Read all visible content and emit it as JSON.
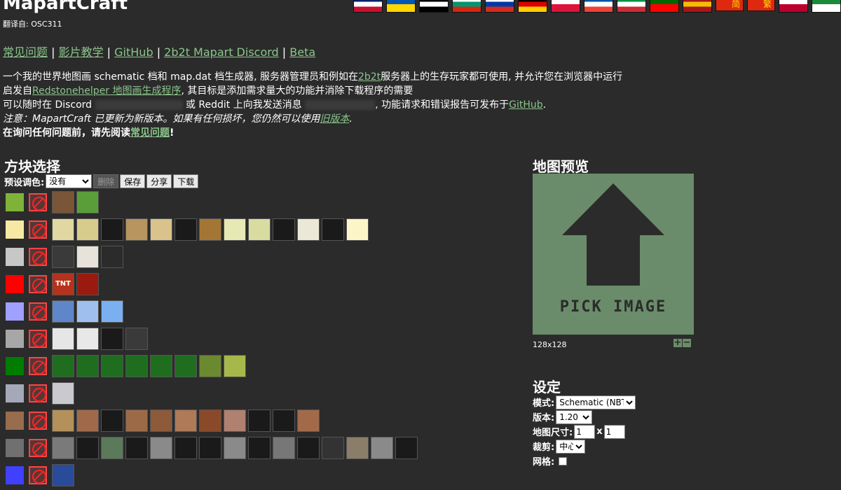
{
  "title": "MapartCraft",
  "translated_by": "翻译自: OSC311",
  "flags": [
    {
      "name": "en",
      "colors": [
        "#012169",
        "#ffffff",
        "#c8102e"
      ]
    },
    {
      "name": "ua",
      "colors": [
        "#0057b7",
        "#ffd700"
      ]
    },
    {
      "name": "de-old",
      "colors": [
        "#000000",
        "#ffffff",
        "#000000"
      ]
    },
    {
      "name": "bg",
      "colors": [
        "#ffffff",
        "#00966e",
        "#d62612"
      ]
    },
    {
      "name": "ru",
      "colors": [
        "#ffffff",
        "#0039a6",
        "#d52b1e"
      ]
    },
    {
      "name": "de",
      "colors": [
        "#000000",
        "#dd0000",
        "#ffce00"
      ]
    },
    {
      "name": "pl",
      "colors": [
        "#ffffff",
        "#dc143c"
      ]
    },
    {
      "name": "fr",
      "colors": [
        "#0055a4",
        "#ffffff",
        "#ef4135"
      ]
    },
    {
      "name": "it",
      "colors": [
        "#009246",
        "#ffffff",
        "#ce2b37"
      ]
    },
    {
      "name": "pt",
      "colors": [
        "#006600",
        "#ff0000"
      ]
    },
    {
      "name": "es",
      "colors": [
        "#aa151b",
        "#f1bf00",
        "#aa151b"
      ]
    },
    {
      "name": "zh-cn",
      "colors": [
        "#de2910",
        "#de2910"
      ],
      "label": "简"
    },
    {
      "name": "zh-tw",
      "colors": [
        "#de2910",
        "#de2910"
      ],
      "label": "繁"
    },
    {
      "name": "jp",
      "colors": [
        "#ffffff",
        "#bc002d"
      ]
    },
    {
      "name": "extra",
      "colors": [
        "#1b8a3a",
        "#ffffff"
      ]
    }
  ],
  "nav": {
    "faq": "常见问题",
    "video": "影片教学",
    "github": "GitHub",
    "discord": "2b2t Mapart Discord",
    "beta": "Beta"
  },
  "desc": {
    "line1_a": "一个我的世界地图画 schematic 档和 map.dat 档生成器, 服务器管理员和例如在",
    "line1_link": "2b2t",
    "line1_b": "服务器上的生存玩家都可使用, 并允许您在浏览器中运行",
    "line2_a": "启发自",
    "line2_link": "Redstonehelper 地图画生成程序",
    "line2_b": ", 其目标是添加需求量大的功能并消除下载程序的需要",
    "line3_a": "可以随时在 Discord",
    "line3_b": "或 Reddit 上向我发送消息",
    "line3_c": ", 功能请求和错误报告可发布于",
    "line3_link": "GitHub",
    "line3_d": ".",
    "line4_a": "注意：MapartCraft 已更新为新版本。如果有任何损坏，您仍然可以使用",
    "line4_link": "旧版本",
    "line4_b": ".",
    "line5_a": "在询问任何问题前，请先阅读",
    "line5_link": "常见问题",
    "line5_b": "!"
  },
  "blocks": {
    "heading": "方块选择",
    "preset_label": "预设调色:",
    "preset_value": "没有",
    "delete": "删除",
    "save": "保存",
    "share": "分享",
    "download": "下载",
    "tnt_label": "TNT",
    "rows": [
      {
        "swatch": "#7fb238",
        "tiles": [
          "#7a5537",
          "#5a9e3a"
        ]
      },
      {
        "swatch": "#f7e9a3",
        "tiles": [
          "#e0d7a2",
          "#d8cc8c",
          "#1a1a1a",
          "#b8945f",
          "#d9c28c",
          "#1a1a1a",
          "#a47636",
          "#e7e9b5",
          "#d8dca0",
          "#1a1a1a",
          "#ece8d8",
          "#1a1a1a",
          "#fcf5c7"
        ]
      },
      {
        "swatch": "#c7c7c7",
        "tiles": [
          "#3a3a3a",
          "#e7e2da",
          "#2b2b2b"
        ]
      },
      {
        "swatch": "#ff0000",
        "tiles": [
          "#b5321c",
          "#9a1a0f"
        ]
      },
      {
        "swatch": "#a0a0ff",
        "tiles": [
          "#5f86c8",
          "#9fc0ef",
          "#7ab0f0"
        ]
      },
      {
        "swatch": "#a7a7a7",
        "tiles": [
          "#e6e6e6",
          "#e8e8e8",
          "#1a1a1a",
          "#3a3a3a"
        ]
      },
      {
        "swatch": "#007c00",
        "tiles": [
          "#1f6e1f",
          "#1f6e1f",
          "#1f6e1f",
          "#1f6e1f",
          "#1f6e1f",
          "#1f6e1f",
          "#6b8a2f",
          "#a7b84a"
        ]
      },
      {
        "swatch": "#a4a8b8",
        "tiles": [
          "#c9c9cf"
        ]
      },
      {
        "swatch": "#976d4d",
        "tiles": [
          "#b4905a",
          "#a06a4a",
          "#1a1a1a",
          "#9d6a48",
          "#8d5a3a",
          "#ae7a58",
          "#8a4a2a",
          "#b08070",
          "#1a1a1a",
          "#1a1a1a",
          "#a36a4a"
        ]
      },
      {
        "swatch": "#707070",
        "tiles": [
          "#7a7a7a",
          "#1a1a1a",
          "#5a7a5a",
          "#1a1a1a",
          "#8a8a8a",
          "#1a1a1a",
          "#1a1a1a",
          "#8a8a8a",
          "#1a1a1a",
          "#777777",
          "#1a1a1a",
          "#333333",
          "#8a7e6a",
          "#8a8a8a",
          "#1a1a1a"
        ]
      },
      {
        "swatch": "#4040ff",
        "tiles": [
          "#2a4a9a"
        ]
      }
    ]
  },
  "preview": {
    "heading": "地图预览",
    "pick_text": "PICK IMAGE",
    "size": "128x128",
    "zoom_in": "+",
    "zoom_out": "−",
    "bg_color": "#6a8c6a"
  },
  "settings": {
    "heading": "设定",
    "mode_label": "模式:",
    "mode_value": "Schematic (NBT)",
    "version_label": "版本:",
    "version_value": "1.20",
    "mapsize_label": "地图尺寸:",
    "mapsize_w": "1",
    "mapsize_x": "x",
    "mapsize_h": "1",
    "crop_label": "裁剪:",
    "crop_value": "中心",
    "grid_label": "网格:"
  }
}
